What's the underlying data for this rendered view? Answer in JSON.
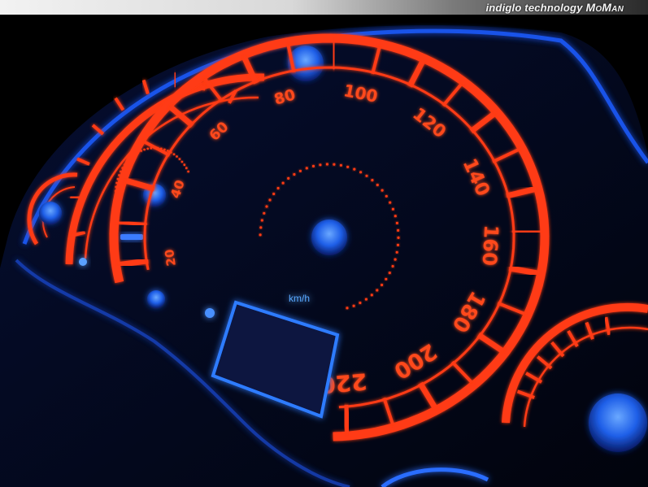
{
  "header": {
    "brand_line": "indiglo technology",
    "brand_strong": "MoMan"
  },
  "speedometer": {
    "unit": "km/h",
    "labels": [
      "20",
      "40",
      "60",
      "80",
      "100",
      "120",
      "140",
      "160",
      "180",
      "200",
      "220"
    ]
  },
  "colors": {
    "glow_red": "#ff3a12",
    "glow_blue": "#2a6dff",
    "background": "#000000"
  }
}
